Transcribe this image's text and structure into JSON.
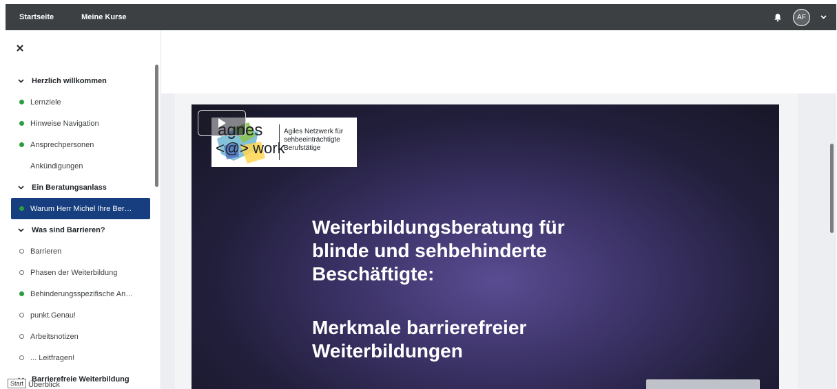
{
  "topbar": {
    "links": [
      "Startseite",
      "Meine Kurse"
    ],
    "avatar_initials": "AF"
  },
  "sidebar": {
    "items": [
      {
        "type": "section",
        "label": "Herzlich willkommen"
      },
      {
        "type": "item",
        "label": "Lernziele",
        "status": "complete"
      },
      {
        "type": "item",
        "label": "Hinweise Navigation",
        "status": "complete"
      },
      {
        "type": "item",
        "label": "Ansprechpersonen",
        "status": "complete"
      },
      {
        "type": "item",
        "label": "Ankündigungen",
        "status": "none"
      },
      {
        "type": "section",
        "label": "Ein Beratungsanlass"
      },
      {
        "type": "item",
        "label": "Warum Herr Michel Ihre Ber…",
        "status": "complete",
        "active": true
      },
      {
        "type": "section",
        "label": "Was sind Barrieren?"
      },
      {
        "type": "item",
        "label": "Barrieren",
        "status": "incomplete"
      },
      {
        "type": "item",
        "label": "Phasen der Weiterbildung",
        "status": "incomplete"
      },
      {
        "type": "item",
        "label": "Behinderungsspezifische An…",
        "status": "complete"
      },
      {
        "type": "item",
        "label": "punkt.Genau!",
        "status": "incomplete"
      },
      {
        "type": "item",
        "label": "Arbeitsnotizen",
        "status": "incomplete"
      },
      {
        "type": "item",
        "label": "... Leitfragen!",
        "status": "incomplete"
      },
      {
        "type": "section",
        "label": "Barrierefreie Weiterbildung"
      }
    ],
    "tooltip": "Start",
    "partial_item": "Überblick"
  },
  "video": {
    "logo_word1": "agnes",
    "logo_word2": "<@> work",
    "logo_tagline": "Agiles Netzwerk für\nsehbeeinträchtigte\nBerufstätige",
    "title": "Weiterbildungsberatung für\nblinde und sehbehinderte\nBeschäftigte:",
    "subtitle": "Merkmale barrierefreier\nWeiterbildungen"
  },
  "colors": {
    "topbar": "#3d4043",
    "active_item": "#173f7f",
    "complete_dot": "#2a9d3f"
  }
}
